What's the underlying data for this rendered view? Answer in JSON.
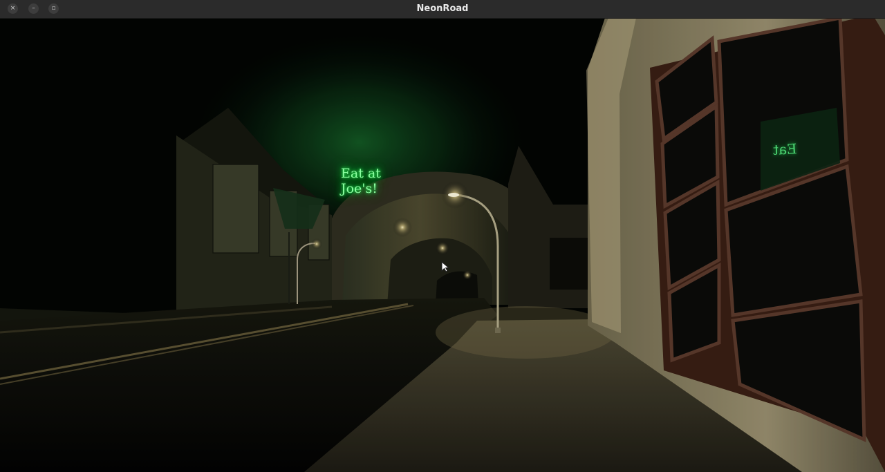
{
  "window": {
    "title": "NeonRoad",
    "controls": {
      "close_icon": "×",
      "minimize_icon": "–",
      "maximize_icon": "▫"
    }
  },
  "scene": {
    "neon_sign_line1": "Eat at",
    "neon_sign_line2": "Joe's!",
    "neon_reflection_text": "Eat",
    "neon_color": "#2cff5e",
    "lamp_light_color": "#fff3c4",
    "icons": [
      "street-lamp-icon",
      "mouse-cursor-icon"
    ]
  }
}
